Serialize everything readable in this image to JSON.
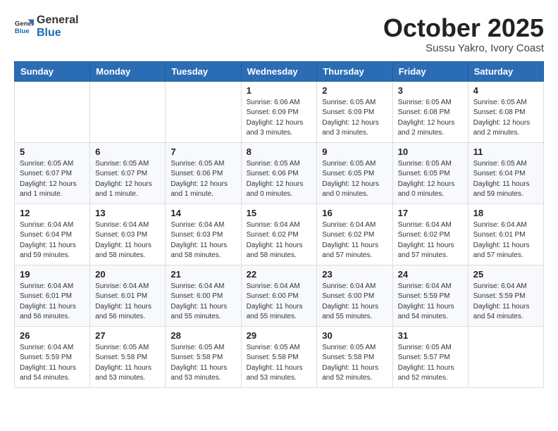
{
  "header": {
    "logo_line1": "General",
    "logo_line2": "Blue",
    "month": "October 2025",
    "location": "Sussu Yakro, Ivory Coast"
  },
  "weekdays": [
    "Sunday",
    "Monday",
    "Tuesday",
    "Wednesday",
    "Thursday",
    "Friday",
    "Saturday"
  ],
  "weeks": [
    [
      {
        "day": "",
        "info": ""
      },
      {
        "day": "",
        "info": ""
      },
      {
        "day": "",
        "info": ""
      },
      {
        "day": "1",
        "info": "Sunrise: 6:06 AM\nSunset: 6:09 PM\nDaylight: 12 hours\nand 3 minutes."
      },
      {
        "day": "2",
        "info": "Sunrise: 6:05 AM\nSunset: 6:09 PM\nDaylight: 12 hours\nand 3 minutes."
      },
      {
        "day": "3",
        "info": "Sunrise: 6:05 AM\nSunset: 6:08 PM\nDaylight: 12 hours\nand 2 minutes."
      },
      {
        "day": "4",
        "info": "Sunrise: 6:05 AM\nSunset: 6:08 PM\nDaylight: 12 hours\nand 2 minutes."
      }
    ],
    [
      {
        "day": "5",
        "info": "Sunrise: 6:05 AM\nSunset: 6:07 PM\nDaylight: 12 hours\nand 1 minute."
      },
      {
        "day": "6",
        "info": "Sunrise: 6:05 AM\nSunset: 6:07 PM\nDaylight: 12 hours\nand 1 minute."
      },
      {
        "day": "7",
        "info": "Sunrise: 6:05 AM\nSunset: 6:06 PM\nDaylight: 12 hours\nand 1 minute."
      },
      {
        "day": "8",
        "info": "Sunrise: 6:05 AM\nSunset: 6:06 PM\nDaylight: 12 hours\nand 0 minutes."
      },
      {
        "day": "9",
        "info": "Sunrise: 6:05 AM\nSunset: 6:05 PM\nDaylight: 12 hours\nand 0 minutes."
      },
      {
        "day": "10",
        "info": "Sunrise: 6:05 AM\nSunset: 6:05 PM\nDaylight: 12 hours\nand 0 minutes."
      },
      {
        "day": "11",
        "info": "Sunrise: 6:05 AM\nSunset: 6:04 PM\nDaylight: 11 hours\nand 59 minutes."
      }
    ],
    [
      {
        "day": "12",
        "info": "Sunrise: 6:04 AM\nSunset: 6:04 PM\nDaylight: 11 hours\nand 59 minutes."
      },
      {
        "day": "13",
        "info": "Sunrise: 6:04 AM\nSunset: 6:03 PM\nDaylight: 11 hours\nand 58 minutes."
      },
      {
        "day": "14",
        "info": "Sunrise: 6:04 AM\nSunset: 6:03 PM\nDaylight: 11 hours\nand 58 minutes."
      },
      {
        "day": "15",
        "info": "Sunrise: 6:04 AM\nSunset: 6:02 PM\nDaylight: 11 hours\nand 58 minutes."
      },
      {
        "day": "16",
        "info": "Sunrise: 6:04 AM\nSunset: 6:02 PM\nDaylight: 11 hours\nand 57 minutes."
      },
      {
        "day": "17",
        "info": "Sunrise: 6:04 AM\nSunset: 6:02 PM\nDaylight: 11 hours\nand 57 minutes."
      },
      {
        "day": "18",
        "info": "Sunrise: 6:04 AM\nSunset: 6:01 PM\nDaylight: 11 hours\nand 57 minutes."
      }
    ],
    [
      {
        "day": "19",
        "info": "Sunrise: 6:04 AM\nSunset: 6:01 PM\nDaylight: 11 hours\nand 56 minutes."
      },
      {
        "day": "20",
        "info": "Sunrise: 6:04 AM\nSunset: 6:01 PM\nDaylight: 11 hours\nand 56 minutes."
      },
      {
        "day": "21",
        "info": "Sunrise: 6:04 AM\nSunset: 6:00 PM\nDaylight: 11 hours\nand 55 minutes."
      },
      {
        "day": "22",
        "info": "Sunrise: 6:04 AM\nSunset: 6:00 PM\nDaylight: 11 hours\nand 55 minutes."
      },
      {
        "day": "23",
        "info": "Sunrise: 6:04 AM\nSunset: 6:00 PM\nDaylight: 11 hours\nand 55 minutes."
      },
      {
        "day": "24",
        "info": "Sunrise: 6:04 AM\nSunset: 5:59 PM\nDaylight: 11 hours\nand 54 minutes."
      },
      {
        "day": "25",
        "info": "Sunrise: 6:04 AM\nSunset: 5:59 PM\nDaylight: 11 hours\nand 54 minutes."
      }
    ],
    [
      {
        "day": "26",
        "info": "Sunrise: 6:04 AM\nSunset: 5:59 PM\nDaylight: 11 hours\nand 54 minutes."
      },
      {
        "day": "27",
        "info": "Sunrise: 6:05 AM\nSunset: 5:58 PM\nDaylight: 11 hours\nand 53 minutes."
      },
      {
        "day": "28",
        "info": "Sunrise: 6:05 AM\nSunset: 5:58 PM\nDaylight: 11 hours\nand 53 minutes."
      },
      {
        "day": "29",
        "info": "Sunrise: 6:05 AM\nSunset: 5:58 PM\nDaylight: 11 hours\nand 53 minutes."
      },
      {
        "day": "30",
        "info": "Sunrise: 6:05 AM\nSunset: 5:58 PM\nDaylight: 11 hours\nand 52 minutes."
      },
      {
        "day": "31",
        "info": "Sunrise: 6:05 AM\nSunset: 5:57 PM\nDaylight: 11 hours\nand 52 minutes."
      },
      {
        "day": "",
        "info": ""
      }
    ]
  ]
}
